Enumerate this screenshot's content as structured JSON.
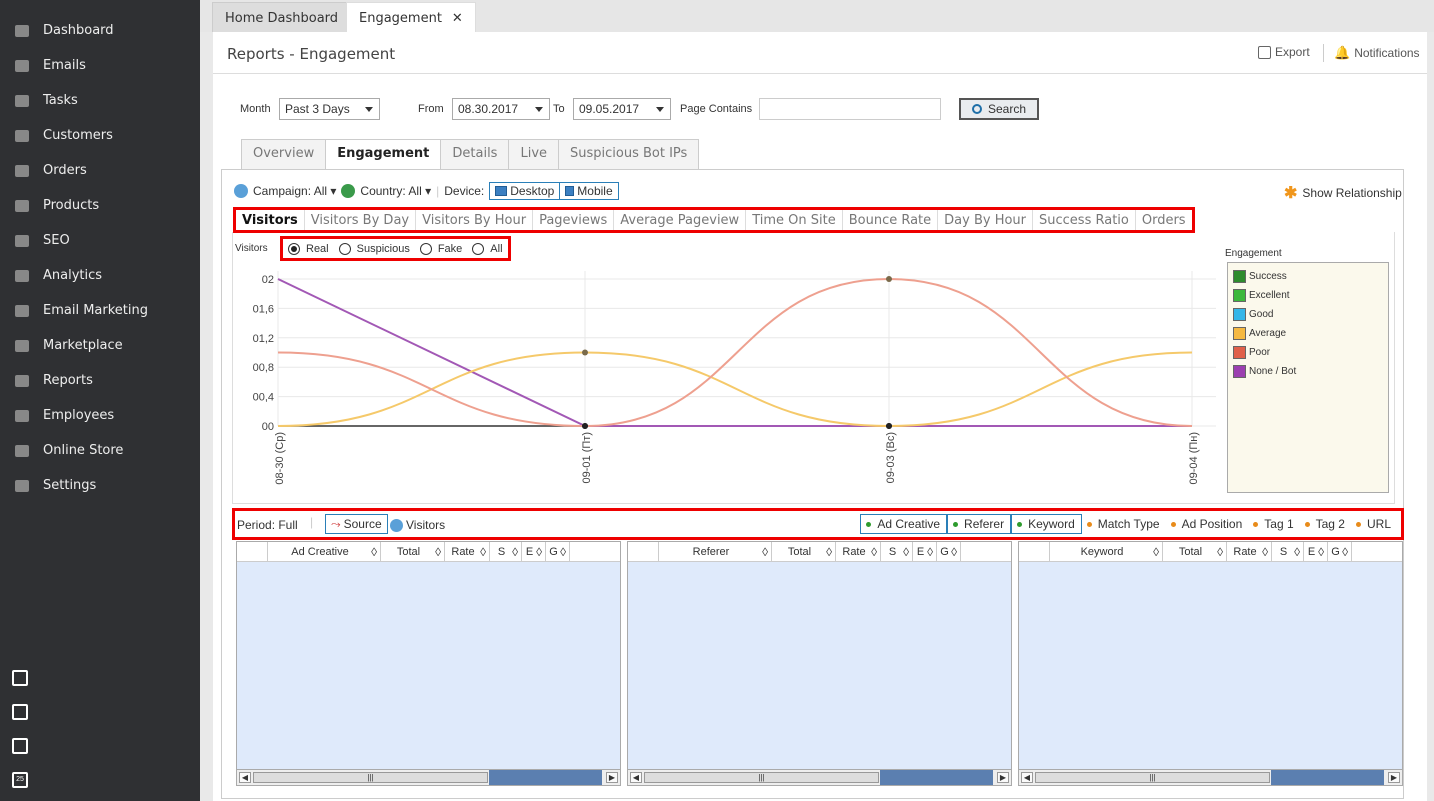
{
  "sidebar": {
    "items": [
      {
        "label": "Dashboard",
        "icon": "home-icon"
      },
      {
        "label": "Emails",
        "icon": "envelope-icon"
      },
      {
        "label": "Tasks",
        "icon": "tasks-icon"
      },
      {
        "label": "Customers",
        "icon": "user-icon"
      },
      {
        "label": "Orders",
        "icon": "cart-icon"
      },
      {
        "label": "Products",
        "icon": "tag-icon"
      },
      {
        "label": "SEO",
        "icon": "sliders-icon"
      },
      {
        "label": "Analytics",
        "icon": "bar-chart-icon"
      },
      {
        "label": "Email Marketing",
        "icon": "megaphone-icon"
      },
      {
        "label": "Marketplace",
        "icon": "share-icon"
      },
      {
        "label": "Reports",
        "icon": "pie-chart-icon"
      },
      {
        "label": "Employees",
        "icon": "users-icon"
      },
      {
        "label": "Online Store",
        "icon": "globe-icon"
      },
      {
        "label": "Settings",
        "icon": "gear-icon"
      }
    ],
    "bottom_icons": [
      "windows-icon",
      "lightbulb-icon",
      "calculator-icon",
      "calendar-icon"
    ],
    "calendar_day": "25"
  },
  "top_tabs": {
    "home": "Home Dashboard",
    "engagement": "Engagement",
    "close": "✕"
  },
  "header": {
    "title": "Reports - Engagement",
    "export": "Export",
    "notifications": "Notifications"
  },
  "filters": {
    "month_label": "Month",
    "month_value": "Past 3 Days",
    "from_label": "From",
    "from_value": "08.30.2017",
    "to_label": "To",
    "to_value": "09.05.2017",
    "page_contains_label": "Page Contains",
    "page_contains_value": "",
    "search": "Search"
  },
  "subtabs": [
    "Overview",
    "Engagement",
    "Details",
    "Live",
    "Suspicious Bot IPs"
  ],
  "toolbar": {
    "campaign": "Campaign: All",
    "country": "Country: All",
    "device_label": "Device:",
    "desktop": "Desktop",
    "mobile": "Mobile",
    "show_relationship": "Show Relationship"
  },
  "metric_tabs": [
    "Visitors",
    "Visitors By Day",
    "Visitors By Hour",
    "Pageviews",
    "Average Pageview",
    "Time On Site",
    "Bounce Rate",
    "Day By Hour",
    "Success Ratio",
    "Orders"
  ],
  "visitor_filter": {
    "label": "Visitors",
    "options": [
      "Real",
      "Suspicious",
      "Fake",
      "All"
    ],
    "selected": "Real"
  },
  "legend": {
    "title": "Engagement",
    "items": [
      {
        "label": "Success",
        "color": "#2e8b2e"
      },
      {
        "label": "Excellent",
        "color": "#3cb83c"
      },
      {
        "label": "Good",
        "color": "#35b6e8"
      },
      {
        "label": "Average",
        "color": "#f5b942"
      },
      {
        "label": "Poor",
        "color": "#e0604a"
      },
      {
        "label": "None / Bot",
        "color": "#9b3fb0"
      }
    ]
  },
  "chart_data": {
    "type": "line",
    "x": [
      "08-30 (Ср)",
      "09-01 (Пт)",
      "09-03 (Вс)",
      "09-04 (Пн)"
    ],
    "ytick_labels": [
      "00",
      "00,4",
      "00,8",
      "01,2",
      "01,6",
      "02"
    ],
    "ylim": [
      0,
      2
    ],
    "grid": true,
    "series": [
      {
        "name": "None / Bot",
        "color": "#a258b5",
        "values": [
          2,
          0,
          0,
          0
        ]
      },
      {
        "name": "Average",
        "color": "#f5c96a",
        "values": [
          0,
          1,
          0,
          1
        ]
      },
      {
        "name": "Poor",
        "color": "#eea08f",
        "values": [
          1,
          0,
          2,
          0
        ]
      }
    ]
  },
  "period": {
    "label": "Period: Full",
    "source": "Source",
    "visitors": "Visitors",
    "filters": [
      {
        "label": "Ad Creative",
        "boxed": true,
        "dot": "green"
      },
      {
        "label": "Referer",
        "boxed": true,
        "dot": "green"
      },
      {
        "label": "Keyword",
        "boxed": true,
        "dot": "green"
      },
      {
        "label": "Match Type",
        "boxed": false,
        "dot": "orange"
      },
      {
        "label": "Ad Position",
        "boxed": false,
        "dot": "orange"
      },
      {
        "label": "Tag 1",
        "boxed": false,
        "dot": "orange"
      },
      {
        "label": "Tag 2",
        "boxed": false,
        "dot": "orange"
      },
      {
        "label": "URL",
        "boxed": false,
        "dot": "orange"
      }
    ]
  },
  "grids": [
    {
      "columns": [
        "",
        "Ad Creative",
        "Total",
        "Rate",
        "S",
        "E",
        "G"
      ]
    },
    {
      "columns": [
        "",
        "Referer",
        "Total",
        "Rate",
        "S",
        "E",
        "G"
      ]
    },
    {
      "columns": [
        "",
        "Keyword",
        "Total",
        "Rate",
        "S",
        "E",
        "G"
      ]
    }
  ],
  "scroll": {
    "left": "◀",
    "right": "▶",
    "grip": "|||"
  }
}
